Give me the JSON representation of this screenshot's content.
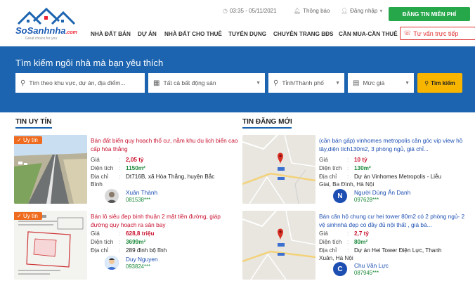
{
  "header": {
    "logo_text": "SoSanhnha",
    "logo_suffix": ".com",
    "logo_tagline": "Great choice for you",
    "datetime": "03:35 - 05/11/2021",
    "notifications": "Thông báo",
    "login": "Đăng nhập",
    "post_button": "ĐĂNG TIN MIỄN PHÍ",
    "nav": [
      "NHÀ ĐẤT BÁN",
      "DỰ ÁN",
      "NHÀ ĐẤT CHO THUÊ",
      "TUYỂN DỤNG",
      "CHUYÊN TRANG BĐS",
      "CẦN MUA-CẦN THUÊ"
    ],
    "consult": "Tư vấn trực tiếp"
  },
  "search": {
    "title": "Tìm kiếm ngôi nhà mà bạn yêu thích",
    "keyword_placeholder": "Tìm theo khu vực, dự án, địa điểm...",
    "type": "Tất cả bất động sản",
    "province": "Tỉnh/Thành phố",
    "price": "Mức giá",
    "button": "Tìm kiếm"
  },
  "sections": {
    "trusted": "TIN UY TÍN",
    "latest": "TIN ĐĂNG MỚI"
  },
  "labels": {
    "price": "Giá",
    "area": "Diện tích",
    "address": "Địa chỉ",
    "badge": "Uy tín"
  },
  "trusted": [
    {
      "title": "Bán đất biển quy hoạch thổ cư, nằm khu du lịch biển cao cấp hòa thắng",
      "price": "2,05 tỷ",
      "area": "1150m²",
      "address_line1": "Dt716B, xã Hòa Thắng, huyện Bắc",
      "address_line2": "Bình",
      "user": "Xuân Thành",
      "phone": "081538***"
    },
    {
      "title": "Bán lô siêu đẹp bình thuận 2 mặt tiền đường, giáp đường quy hoạch ra sân bay",
      "price": "628,8 triệu",
      "area": "3699m²",
      "address_line1": "289 đinh bộ lĩnh",
      "address_line2": "",
      "user": "Duy Nguyen",
      "phone": "093824***"
    }
  ],
  "latest": [
    {
      "title": "(cần bán gấp) vinhomes metropolis căn góc vip view hồ tây,diện tích130m2, 3 phòng ngủ, giá chỉ...",
      "price": "10 tỷ",
      "area": "130m²",
      "address_line1": "Dự án Vinhomes Metropolis - Liễu",
      "address_line2": "Giai, Ba Đình, Hà Nội",
      "user": "Người Dùng Ẩn Danh",
      "phone": "097628***",
      "initial": "N"
    },
    {
      "title": "Bán căn hộ chung cư hei tower 80m2 có 2 phòng ngủ- 2 vệ sinhnhà đẹp có đầy đủ nội thất , giá bá...",
      "price": "2,7 tỷ",
      "area": "80m²",
      "address_line1": "Dự án Hei Tower Điện Lực, Thanh",
      "address_line2": "Xuân, Hà Nội",
      "user": "Chu Văn Lực",
      "phone": "087945***",
      "initial": "C"
    }
  ]
}
